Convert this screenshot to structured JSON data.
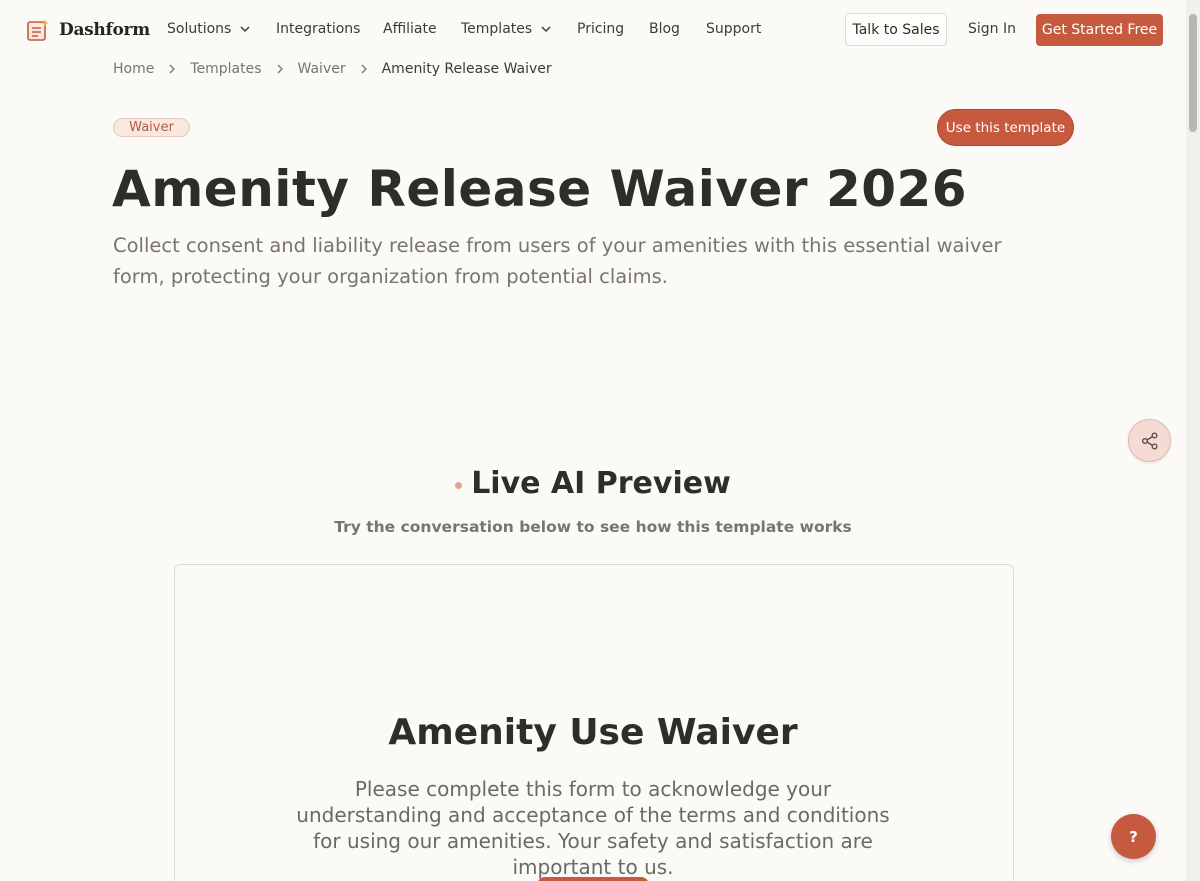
{
  "nav": {
    "logo": "Dashform",
    "links": [
      {
        "label": "Solutions",
        "dropdown": true
      },
      {
        "label": "Integrations",
        "dropdown": false
      },
      {
        "label": "Affiliate",
        "dropdown": false
      },
      {
        "label": "Templates",
        "dropdown": true
      },
      {
        "label": "Pricing",
        "dropdown": false
      },
      {
        "label": "Blog",
        "dropdown": false
      },
      {
        "label": "Support",
        "dropdown": false
      }
    ],
    "talk_to_sales": "Talk to Sales",
    "sign_in": "Sign In",
    "get_started": "Get Started Free"
  },
  "breadcrumb": [
    "Home",
    "Templates",
    "Waiver",
    "Amenity Release Waiver"
  ],
  "hero": {
    "tag": "Waiver",
    "use_template": "Use this template",
    "title": "Amenity Release Waiver 2026",
    "subtitle": "Collect consent and liability release from users of your amenities with this essential waiver form, protecting your organization from potential claims."
  },
  "preview": {
    "title": "Live AI Preview",
    "subtitle": "Try the conversation below to see how this template works",
    "form_title": "Amenity Use Waiver",
    "form_description": "Please complete this form to acknowledge your understanding and acceptance of the terms and conditions for using our amenities. Your safety and satisfaction are important to us."
  },
  "help_label": "?",
  "icons": {
    "logo": "form-sparkle-icon",
    "share": "share-icon",
    "chevron": "chevron-down-icon",
    "breadcrumb_sep": "chevron-right-icon"
  },
  "colors": {
    "accent": "#c65a3e",
    "background": "#fbfaf7",
    "text": "#2f2e26",
    "muted": "#77756c"
  }
}
